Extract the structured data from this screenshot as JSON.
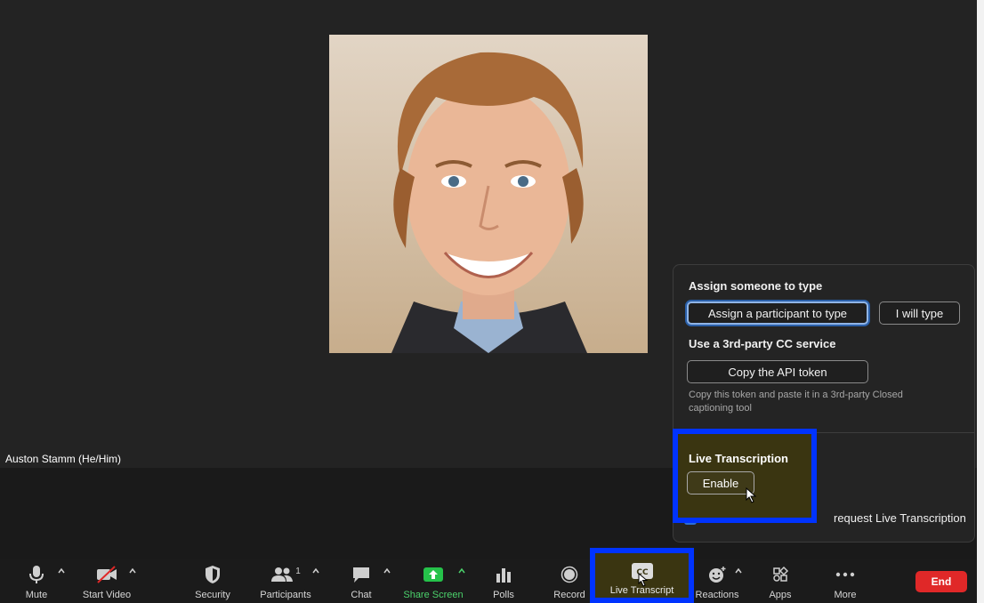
{
  "participant": {
    "name": "Auston Stamm (He/Him)"
  },
  "cc_popup": {
    "assign_title": "Assign someone to type",
    "assign_participant_label": "Assign a participant to type",
    "i_will_type_label": "I will type",
    "third_party_title": "Use a 3rd-party CC service",
    "copy_token_label": "Copy the API token",
    "copy_note": "Copy this token and paste it in a 3rd-party Closed captioning tool",
    "live_transcription_title": "Live Transcription",
    "enable_label": "Enable",
    "request_label": "request Live Transcription"
  },
  "toolbar": {
    "mute": "Mute",
    "start_video": "Start Video",
    "security": "Security",
    "participants": "Participants",
    "participants_count": "1",
    "chat": "Chat",
    "share_screen": "Share Screen",
    "polls": "Polls",
    "record": "Record",
    "live_transcript": "Live Transcript",
    "cc_badge": "CC",
    "reactions": "Reactions",
    "apps": "Apps",
    "more": "More",
    "end": "End"
  },
  "colors": {
    "highlight": "#0033ff",
    "share_green": "#4bd16b",
    "end_red": "#e02828",
    "focus_blue": "#8fb4e6"
  }
}
